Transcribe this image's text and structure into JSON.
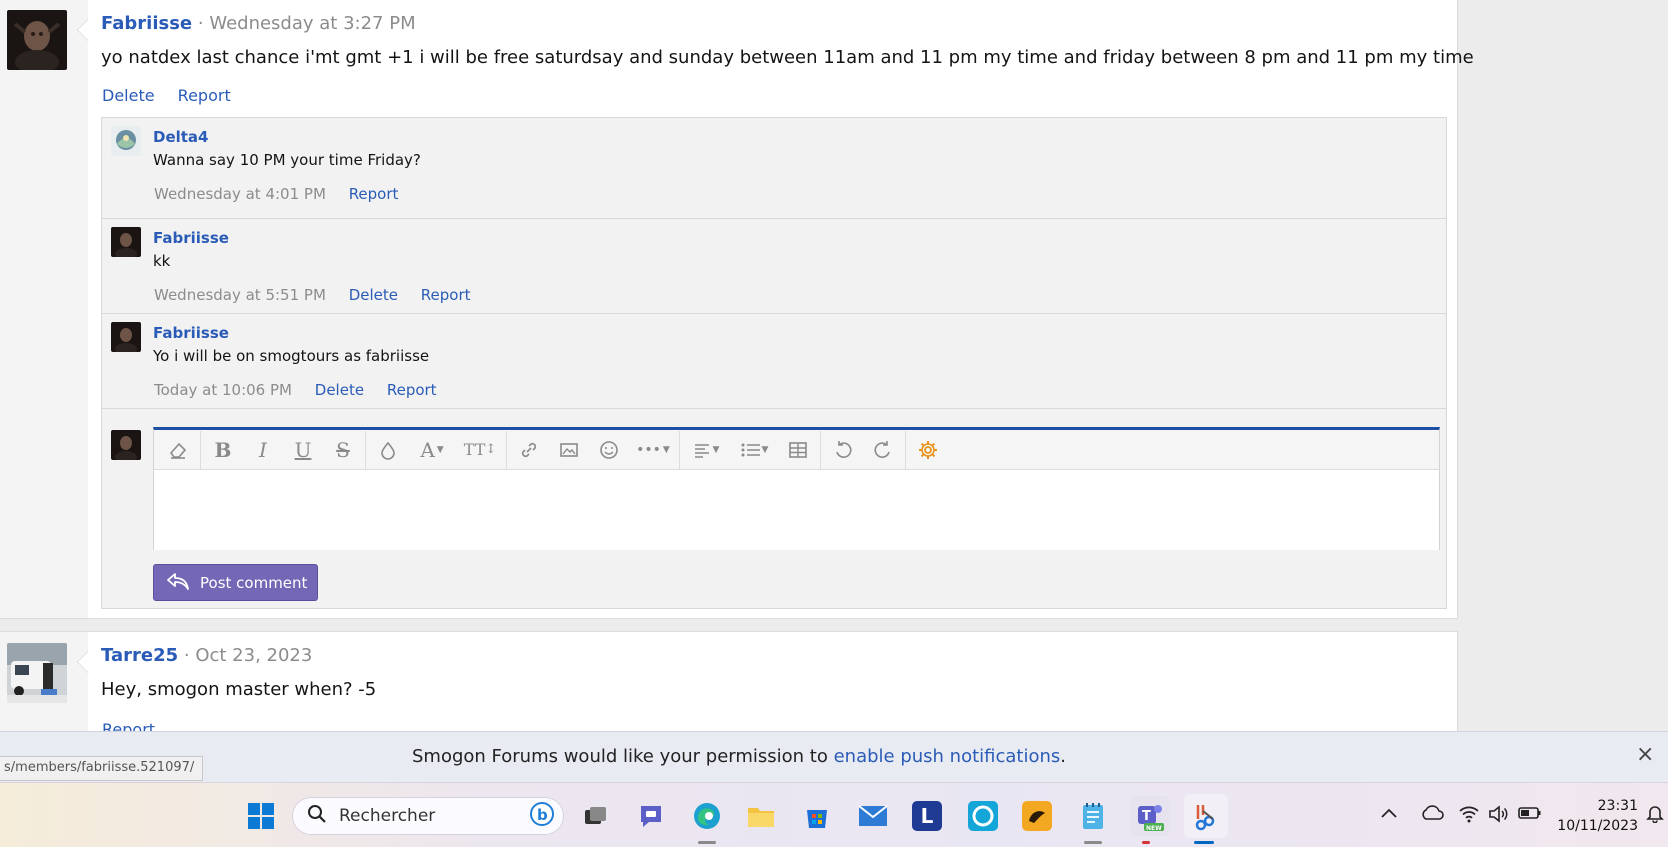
{
  "post1": {
    "author": "Fabriisse",
    "separator": "·",
    "time": "Wednesday at 3:27 PM",
    "body": "yo natdex last chance i'mt gmt +1 i will be free saturdsay and sunday between 11am and 11 pm my time and friday between 8 pm and 11 pm my time",
    "actions": {
      "delete": "Delete",
      "report": "Report"
    }
  },
  "comments": [
    {
      "author": "Delta4",
      "text": "Wanna say 10 PM your time Friday?",
      "time": "Wednesday at 4:01 PM",
      "report": "Report"
    },
    {
      "author": "Fabriisse",
      "text": "kk",
      "time": "Wednesday at 5:51 PM",
      "delete": "Delete",
      "report": "Report"
    },
    {
      "author": "Fabriisse",
      "text": "Yo i will be on smogtours as fabriisse",
      "time": "Today at 10:06 PM",
      "delete": "Delete",
      "report": "Report"
    }
  ],
  "editor": {
    "toolbar": [
      "eraser-icon",
      "bold",
      "italic",
      "underline",
      "strikethrough",
      "color",
      "font-family",
      "font-size",
      "link",
      "image",
      "smilies",
      "more",
      "align",
      "list",
      "table",
      "undo",
      "redo",
      "settings"
    ],
    "toolbar_glyphs": {
      "bold": "B",
      "italic": "I",
      "underline": "U",
      "strike": "S",
      "fontfamily": "A",
      "fontsize": "TT"
    },
    "post_button": "Post comment"
  },
  "post2": {
    "author": "Tarre25",
    "separator": "·",
    "time": "Oct 23, 2023",
    "body": "Hey, smogon master when? -5",
    "actions": {
      "report": "Report"
    }
  },
  "notification": {
    "text_before": "Smogon Forums would like your permission to ",
    "link": "enable push notifications",
    "text_after": ".",
    "close": "×"
  },
  "status_url": "s/members/fabriisse.521097/",
  "taskbar": {
    "search_placeholder": "Rechercher",
    "time": "23:31",
    "date": "10/11/2023",
    "teams_badge": "NEW",
    "mail_letter": "L",
    "accent": "#0067c0"
  },
  "colors": {
    "link": "#2a5cb7",
    "button": "#7467b5",
    "editor_accent": "#1d50a4",
    "gear": "#e8931a"
  }
}
